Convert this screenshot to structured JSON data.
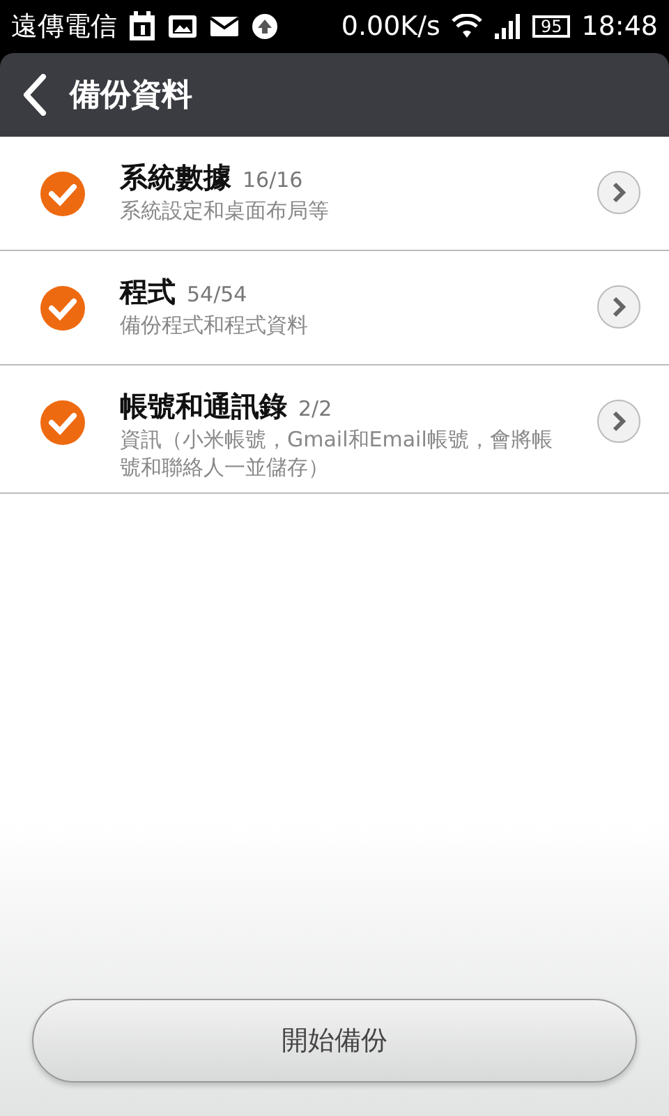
{
  "status_bar": {
    "carrier": "遠傳電信",
    "speed": "0.00K/s",
    "battery": "95",
    "time": "18:48"
  },
  "header": {
    "title": "備份資料"
  },
  "items": [
    {
      "title": "系統數據",
      "count": "16/16",
      "description": "系統設定和桌面布局等",
      "checked": true
    },
    {
      "title": "程式",
      "count": "54/54",
      "description": "備份程式和程式資料",
      "checked": true
    },
    {
      "title": "帳號和通訊錄",
      "count": "2/2",
      "description": "資訊（小米帳號，Gmail和Email帳號，會將帳號和聯絡人一並儲存）",
      "checked": true
    }
  ],
  "button": {
    "label": "開始備份"
  }
}
